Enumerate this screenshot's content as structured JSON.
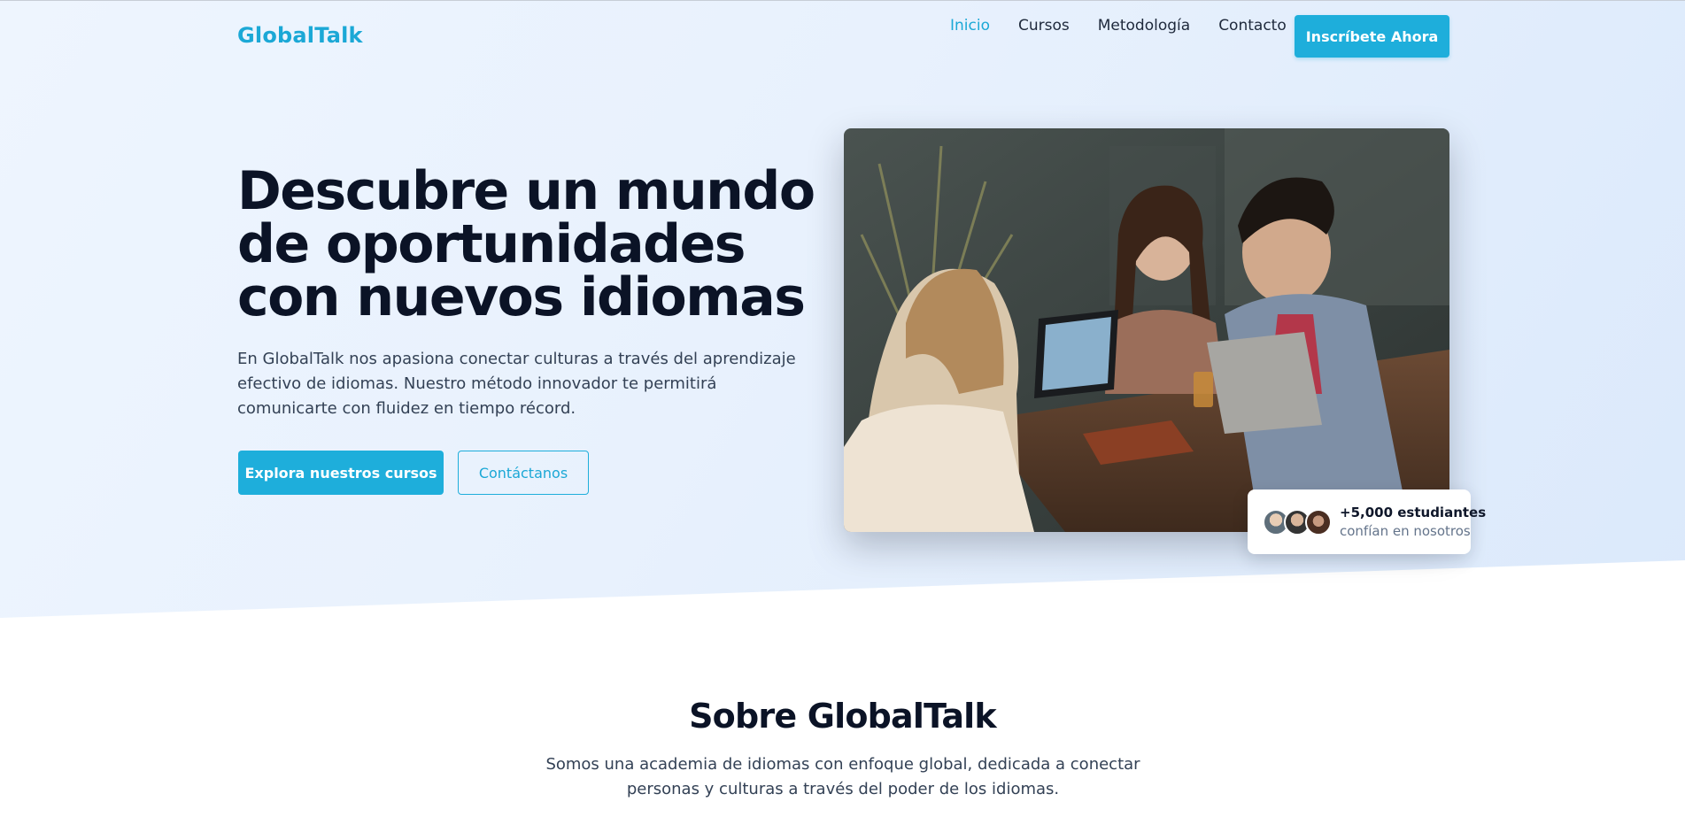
{
  "brand": {
    "name": "GlobalTalk",
    "accent": "#1eaedb"
  },
  "nav": {
    "items": [
      {
        "label": "Inicio",
        "active": true
      },
      {
        "label": "Cursos",
        "active": false
      },
      {
        "label": "Metodología",
        "active": false
      },
      {
        "label": "Contacto",
        "active": false
      }
    ],
    "cta_label": "Inscríbete Ahora"
  },
  "hero": {
    "title": "Descubre un mundo de oportunidades con nuevos idiomas",
    "description": "En GlobalTalk nos apasiona conectar culturas a través del aprendizaje efectivo de idiomas. Nuestro método innovador te permitirá comunicarte con fluidez en tiempo récord.",
    "primary_button": "Explora nuestros cursos",
    "secondary_button": "Contáctanos",
    "image_alt": "students-studying-photo"
  },
  "students_badge": {
    "count": "+5,000 estudiantes",
    "subtitle": "confían en nosotros"
  },
  "about": {
    "title": "Sobre GlobalTalk",
    "description": "Somos una academia de idiomas con enfoque global, dedicada a conectar personas y culturas a través del poder de los idiomas."
  }
}
